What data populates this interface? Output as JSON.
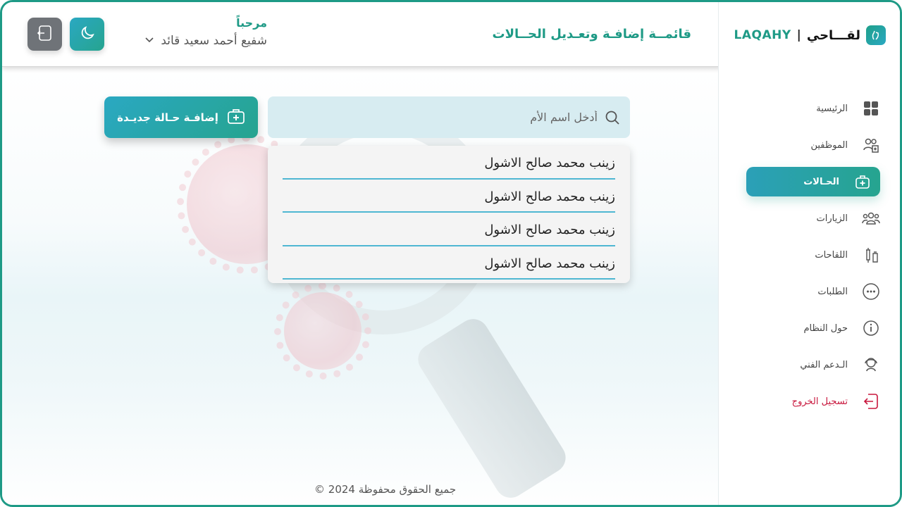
{
  "brand": {
    "name_en": "LAQAHY",
    "separator": "|",
    "name_ar": "لقـــاحي"
  },
  "header": {
    "title": "قائمــة إضافـة وتعـديل الحــالات",
    "welcome": "مرحباً",
    "user_name": "شفيع أحمد سعيد قائد"
  },
  "sidebar": {
    "items": [
      {
        "label": "الرئيسية",
        "icon": "grid-icon"
      },
      {
        "label": "الموظفين",
        "icon": "employees-icon"
      },
      {
        "label": "الحـالات",
        "icon": "medical-case-icon",
        "active": true
      },
      {
        "label": "الزيارات",
        "icon": "group-icon"
      },
      {
        "label": "اللقاحات",
        "icon": "vaccine-icon"
      },
      {
        "label": "الطلبات",
        "icon": "chat-icon"
      },
      {
        "label": "حول النظام",
        "icon": "info-icon"
      },
      {
        "label": "الـدعم الفني",
        "icon": "support-icon"
      },
      {
        "label": "تسجيل الخروج",
        "icon": "logout-icon"
      }
    ]
  },
  "search": {
    "placeholder": "أدخل اسم الأم",
    "value": ""
  },
  "add_button": {
    "label": "إضافـة حـالة جديـدة"
  },
  "results": [
    "زينب محمد صالح الاشول",
    "زينب محمد صالح الاشول",
    "زينب محمد صالح الاشول",
    "زينب محمد صالح الاشول"
  ],
  "footer": {
    "text": "جميع الحقوق محفوظة 2024 ©"
  },
  "colors": {
    "accent": "#1e9a86",
    "accent_blue": "#2aa8c2",
    "logout": "#c8163c",
    "search_bg": "#d7ecf1"
  }
}
